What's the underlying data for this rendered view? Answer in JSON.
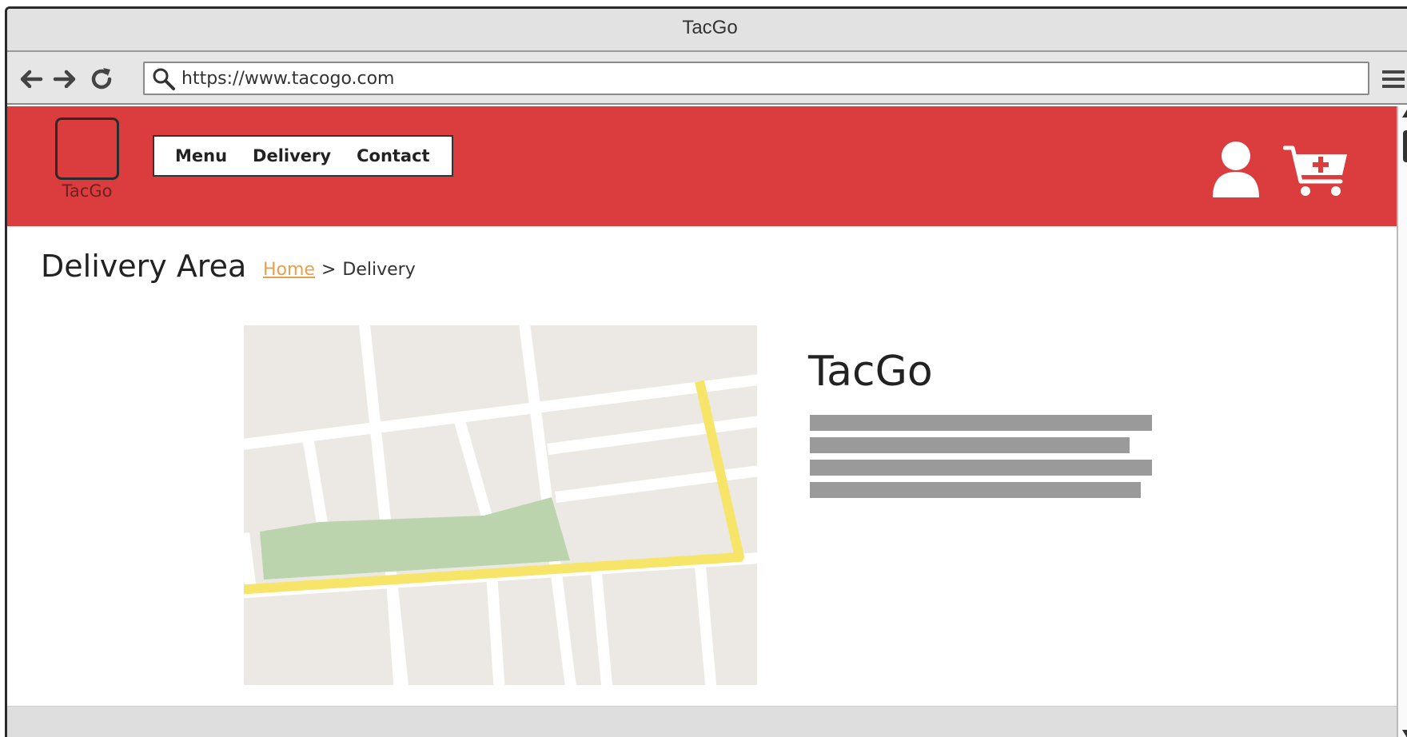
{
  "browser": {
    "window_title": "TacGo",
    "url": "https://www.tacogo.com"
  },
  "header": {
    "logo_text": "TacGo",
    "nav": [
      {
        "label": "Menu"
      },
      {
        "label": "Delivery"
      },
      {
        "label": "Contact"
      }
    ],
    "background_color": "#db3d3f"
  },
  "page": {
    "title": "Delivery Area",
    "breadcrumb": {
      "home": "Home",
      "separator": ">",
      "current": "Delivery"
    }
  },
  "info": {
    "title": "TacGo"
  },
  "icons": [
    "back-arrow-icon",
    "forward-arrow-icon",
    "reload-icon",
    "search-icon",
    "menu-icon",
    "user-icon",
    "cart-add-icon"
  ]
}
